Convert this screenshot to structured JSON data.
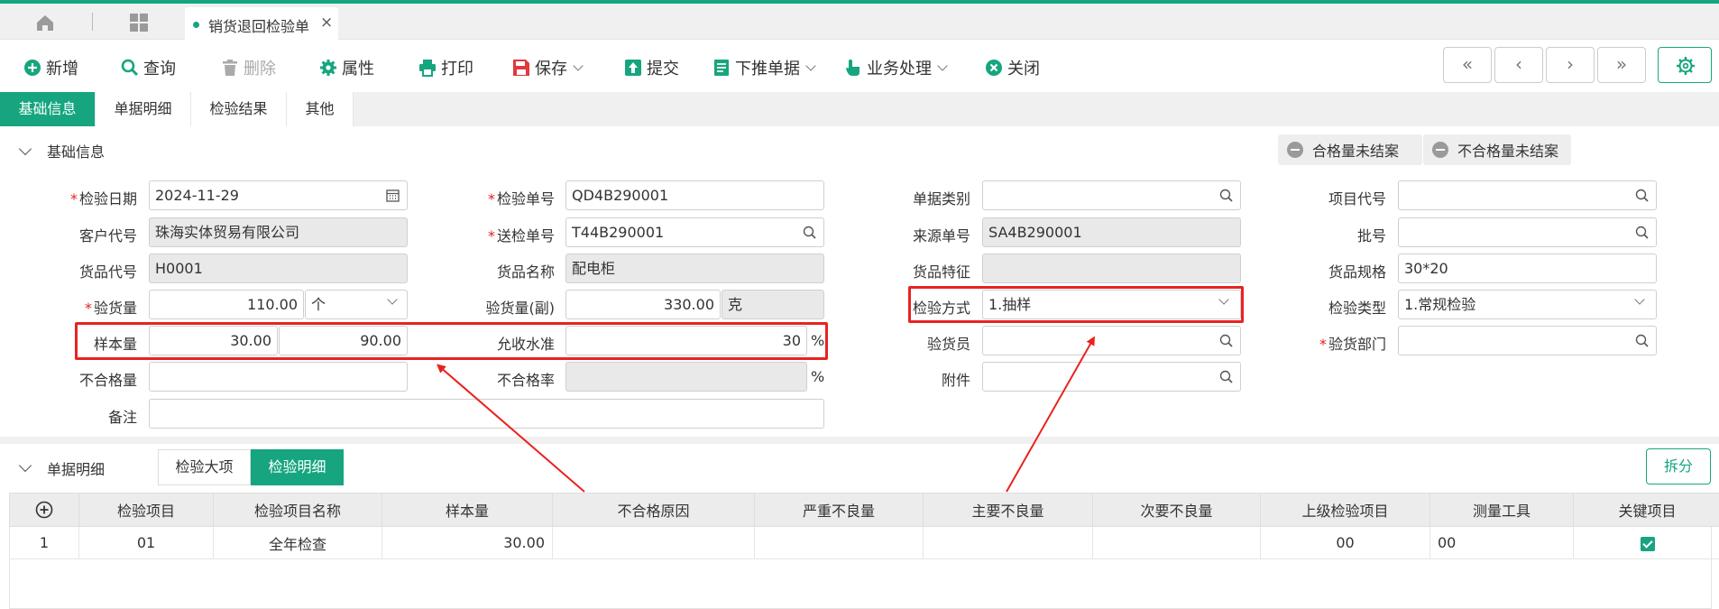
{
  "colors": {
    "accent": "#16a57f",
    "highlight": "#e8231f",
    "required": "#e02020"
  },
  "tabbar": {
    "icons": [
      "home-icon",
      "grid-icon"
    ],
    "doc_tab_label": "销货退回检验单",
    "close_glyph": "×"
  },
  "toolbar": {
    "new": "新增",
    "query": "查询",
    "delete": "删除",
    "props": "属性",
    "print": "打印",
    "save": "保存",
    "submit": "提交",
    "push_down": "下推单据",
    "business": "业务处理",
    "close": "关闭",
    "nav": [
      "«",
      "‹",
      "›",
      "»"
    ]
  },
  "subtabs": [
    "基础信息",
    "单据明细",
    "检验结果",
    "其他"
  ],
  "basic": {
    "title": "基础信息",
    "status_pass": "合格量未结案",
    "status_fail": "不合格量未结案"
  },
  "form": {
    "inspect_date": {
      "label": "检验日期",
      "value": "2024-11-29"
    },
    "inspect_no": {
      "label": "检验单号",
      "value": "QD4B290001"
    },
    "doc_type": {
      "label": "单据类别",
      "value": ""
    },
    "project_code": {
      "label": "项目代号",
      "value": ""
    },
    "customer_code": {
      "label": "客户代号",
      "value": "珠海实体贸易有限公司"
    },
    "send_no": {
      "label": "送检单号",
      "value": "T44B290001"
    },
    "source_no": {
      "label": "来源单号",
      "value": "SA4B290001"
    },
    "batch_no": {
      "label": "批号",
      "value": ""
    },
    "item_code": {
      "label": "货品代号",
      "value": "H0001"
    },
    "item_name": {
      "label": "货品名称",
      "value": "配电柜"
    },
    "item_feature": {
      "label": "货品特征",
      "value": ""
    },
    "item_spec": {
      "label": "货品规格",
      "value": "30*20"
    },
    "inspect_qty": {
      "label": "验货量",
      "value": "110.00",
      "unit": "个"
    },
    "inspect_qty2": {
      "label": "验货量(副)",
      "value": "330.00",
      "unit": "克"
    },
    "inspect_method": {
      "label": "检验方式",
      "value": "1.抽样"
    },
    "inspect_type": {
      "label": "检验类型",
      "value": "1.常规检验"
    },
    "sample_qty": {
      "label": "样本量",
      "value1": "30.00",
      "value2": "90.00"
    },
    "aql": {
      "label": "允收水准",
      "value": "30",
      "unit": "%"
    },
    "inspector": {
      "label": "验货员",
      "value": ""
    },
    "inspect_dept": {
      "label": "验货部门",
      "value": ""
    },
    "defect_qty": {
      "label": "不合格量",
      "value": ""
    },
    "defect_rate": {
      "label": "不合格率",
      "value": "",
      "unit": "%"
    },
    "attachment": {
      "label": "附件",
      "value": ""
    },
    "remark": {
      "label": "备注",
      "value": ""
    }
  },
  "detail": {
    "title": "单据明细",
    "tabs": [
      "检验大项",
      "检验明细"
    ],
    "split": "拆分",
    "columns": [
      "检验项目",
      "检验项目名称",
      "样本量",
      "不合格原因",
      "严重不良量",
      "主要不良量",
      "次要不良量",
      "上级检验项目",
      "测量工具",
      "关键项目"
    ],
    "rows": [
      {
        "idx": "1",
        "item": "01",
        "name": "全年检查",
        "sample": "30.00",
        "reason": "",
        "serious": "",
        "major": "",
        "minor": "",
        "parent": "00",
        "tool": "00",
        "key": true
      }
    ]
  }
}
